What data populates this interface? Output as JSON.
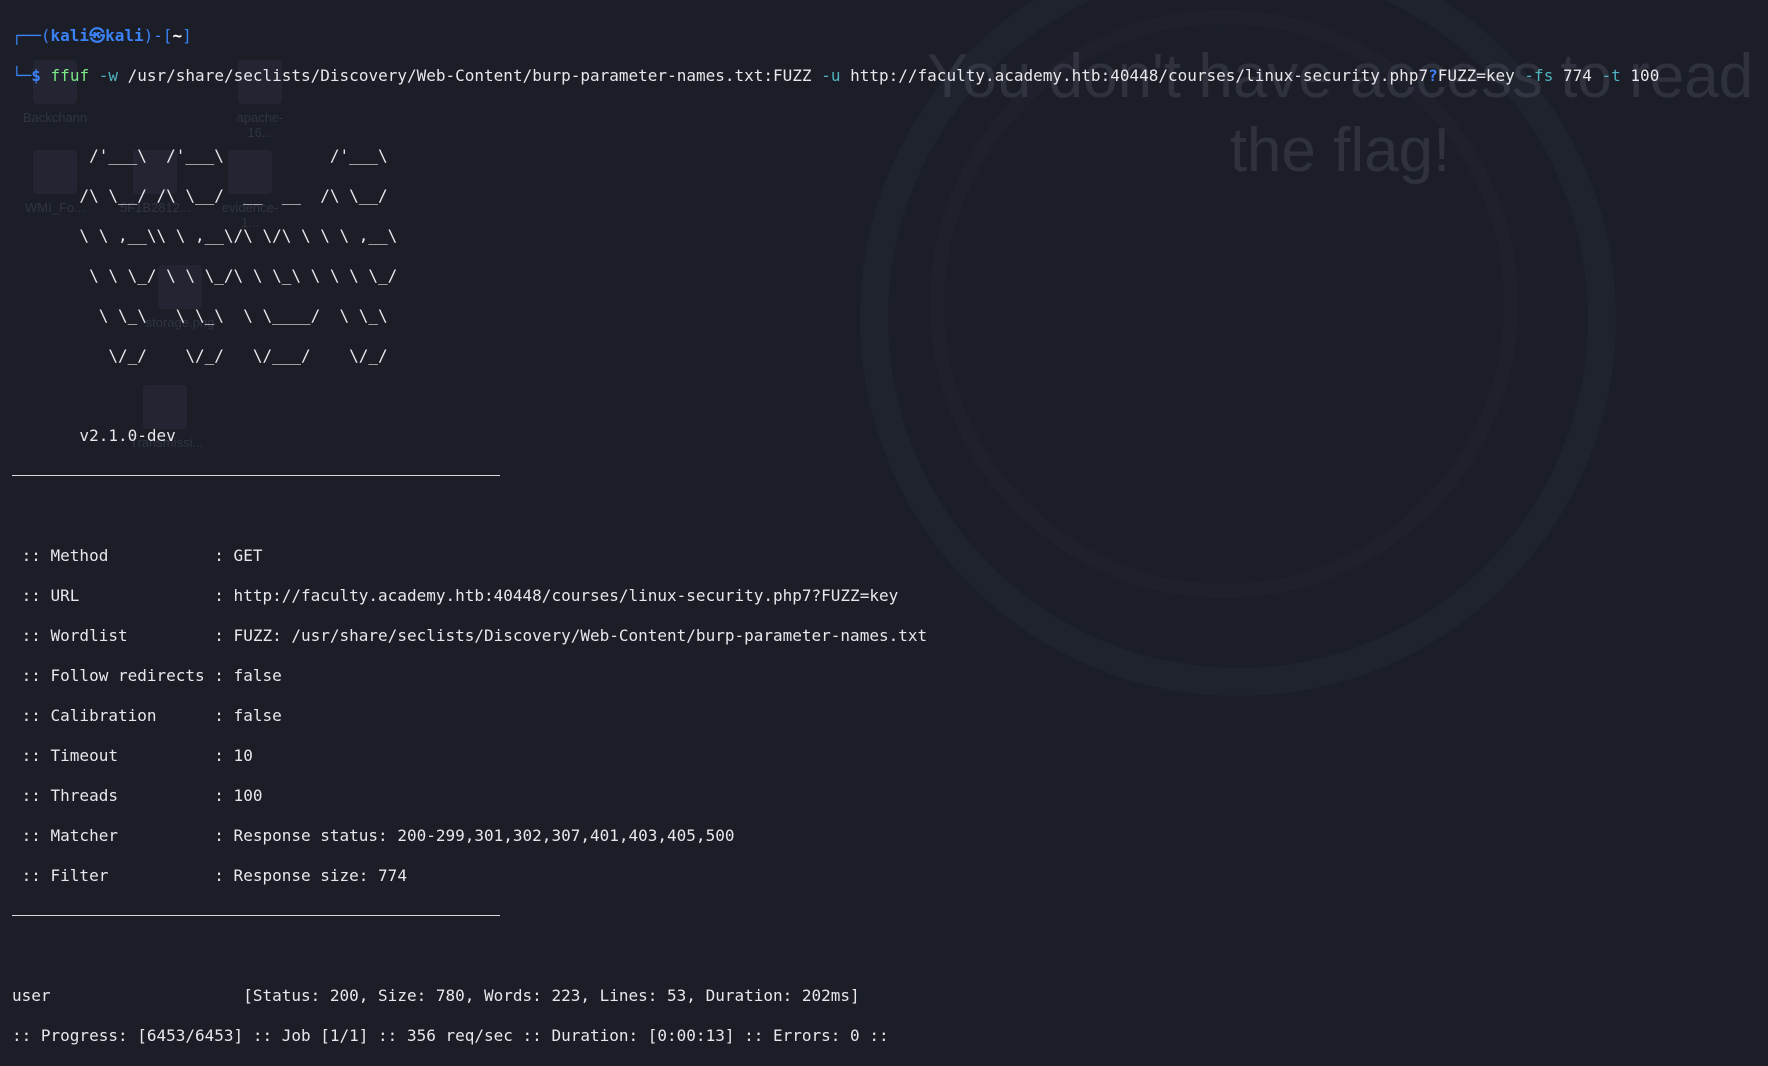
{
  "background": {
    "message": "You don't have access to read the flag!",
    "desktop_icons": [
      "Backchann",
      "WMI_Fo...",
      "5F1B2812...",
      "evidence-1...",
      "apache-16...",
      "storage.png",
      "Transmissi..."
    ]
  },
  "prompt": {
    "user": "kali",
    "separator_icon": "㉿",
    "host": "kali",
    "dir": "~",
    "symbol": "$"
  },
  "command": {
    "program": "ffuf",
    "flag_w": "-w",
    "wordlist": "/usr/share/seclists/Discovery/Web-Content/burp-parameter-names.txt:FUZZ",
    "flag_u": "-u",
    "url_part1": "http://faculty.academy.htb:40448/courses/linux-security.php7",
    "url_q": "?",
    "url_part2": "FUZZ=key",
    "flag_fs": "-fs",
    "fs_value": "774",
    "flag_t": "-t",
    "t_value": "100"
  },
  "banner": {
    "art": [
      "        /'___\\  /'___\\           /'___\\       ",
      "       /\\ \\__/ /\\ \\__/  __  __  /\\ \\__/       ",
      "       \\ \\ ,__\\\\ \\ ,__\\/\\ \\/\\ \\ \\ \\ ,__\\      ",
      "        \\ \\ \\_/ \\ \\ \\_/\\ \\ \\_\\ \\ \\ \\ \\_/      ",
      "         \\ \\_\\   \\ \\_\\  \\ \\____/  \\ \\_\\       ",
      "          \\/_/    \\/_/   \\/___/    \\/_/       "
    ],
    "version": "       v2.1.0-dev"
  },
  "config": [
    " :: Method           : GET",
    " :: URL              : http://faculty.academy.htb:40448/courses/linux-security.php7?FUZZ=key",
    " :: Wordlist         : FUZZ: /usr/share/seclists/Discovery/Web-Content/burp-parameter-names.txt",
    " :: Follow redirects : false",
    " :: Calibration      : false",
    " :: Timeout          : 10",
    " :: Threads          : 100",
    " :: Matcher          : Response status: 200-299,301,302,307,401,403,405,500",
    " :: Filter           : Response size: 774"
  ],
  "results": [
    "user                    [Status: 200, Size: 780, Words: 223, Lines: 53, Duration: 202ms]"
  ],
  "progress": ":: Progress: [6453/6453] :: Job [1/1] :: 356 req/sec :: Duration: [0:00:13] :: Errors: 0 ::"
}
